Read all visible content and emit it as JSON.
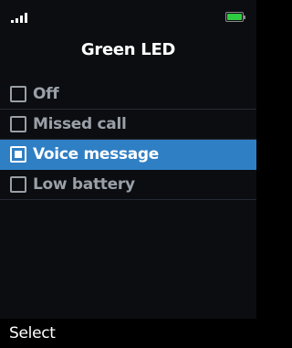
{
  "status": {
    "signal_icon": "signal-strength-icon",
    "battery_icon": "battery-full-icon",
    "battery_color": "#2ecc40"
  },
  "header": {
    "title": "Green LED"
  },
  "options": [
    {
      "label": "Off",
      "checked": false
    },
    {
      "label": "Missed call",
      "checked": false
    },
    {
      "label": "Voice message",
      "checked": true
    },
    {
      "label": "Low battery",
      "checked": false
    }
  ],
  "softkeys": {
    "left": "Select"
  },
  "colors": {
    "highlight": "#2f7fc4",
    "background": "#0b0d11"
  }
}
